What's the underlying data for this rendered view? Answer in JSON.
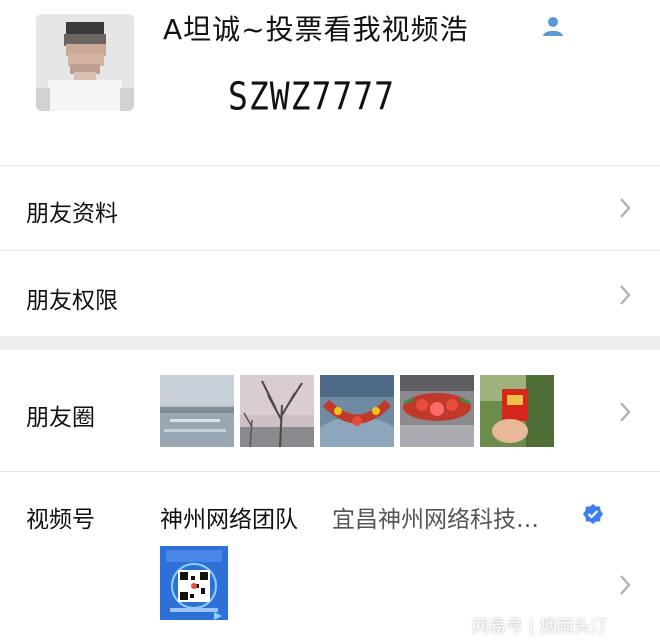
{
  "profile": {
    "nickname": "A坦诚~投票看我视频浩",
    "wechat_id": "SZWZ7777",
    "gender_icon": "user-icon"
  },
  "rows": {
    "info_label": "朋友资料",
    "permissions_label": "朋友权限",
    "moments_label": "朋友圈",
    "channels_label": "视频号"
  },
  "channels": {
    "name": "神州网络团队",
    "org": "宜昌神州网络科技…"
  },
  "watermark": "网易号 | 烟雨头汀",
  "colors": {
    "accent": "#5b9bd5",
    "verified": "#3d7ef0",
    "divider": "#e6e6e6",
    "section_gap": "#ededed"
  }
}
